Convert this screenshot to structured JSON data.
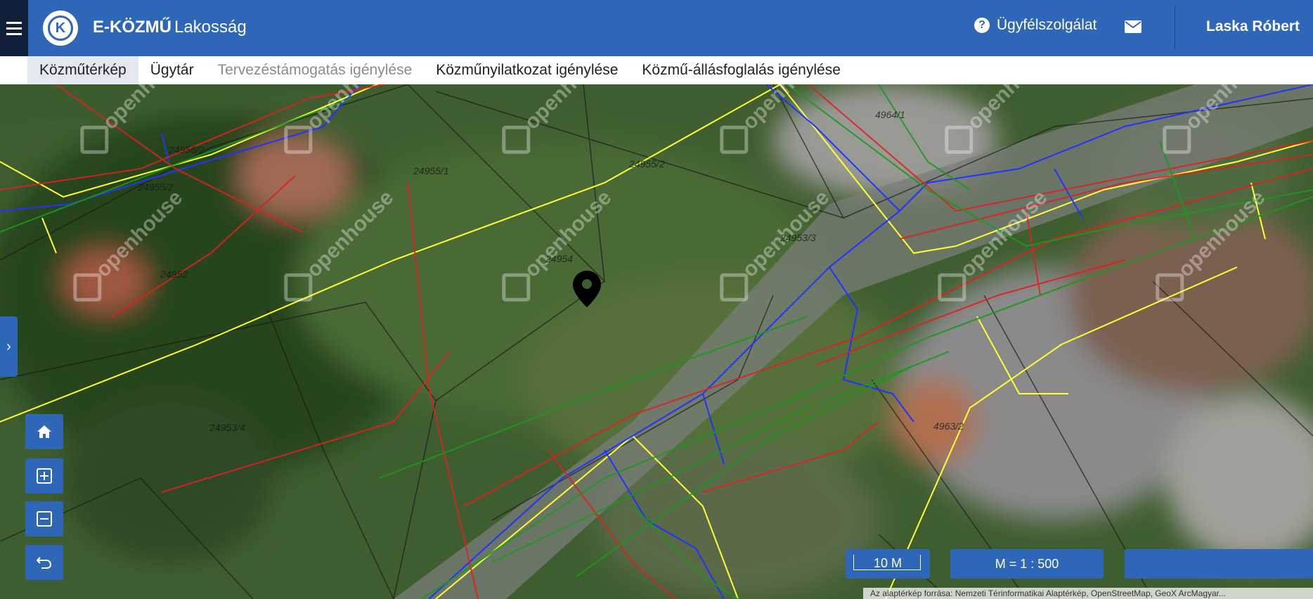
{
  "header": {
    "brand_bold": "E-KÖZMŰ",
    "brand_light": "Lakosság",
    "logo_letter": "K",
    "help_label": "Ügyfélszolgálat",
    "user_name": "Laska Róbert"
  },
  "nav": {
    "items": [
      {
        "label": "Közműtérkép",
        "state": "active"
      },
      {
        "label": "Ügytár",
        "state": "normal"
      },
      {
        "label": "Tervezéstámogatás igénylése",
        "state": "disabled"
      },
      {
        "label": "Közműnyilatkozat igénylése",
        "state": "normal"
      },
      {
        "label": "Közmű-állásfoglalás igénylése",
        "state": "normal"
      }
    ]
  },
  "map": {
    "parcel_labels": [
      "24956/2",
      "24955/2",
      "4964/1",
      "24955/1",
      "24955/2",
      "24954",
      "24953/3",
      "24952",
      "24953/4",
      "4963/2"
    ],
    "watermark": "openhouse",
    "controls": [
      "home-icon",
      "zoom-in-icon",
      "zoom-out-icon",
      "back-icon"
    ],
    "scale_label": "10 M",
    "ratio_label": "M = 1 : 500",
    "attribution": "Az alaptérkép forrása: Nemzeti Térinformatikai Alaptérkép, OpenStreetMap, GeoX ArcMagyar...",
    "colors": {
      "header": "#2f67b8",
      "gas": "#ffff33",
      "water": "#2233ff",
      "power": "#e02020",
      "telecom": "#1a9a1a"
    }
  }
}
